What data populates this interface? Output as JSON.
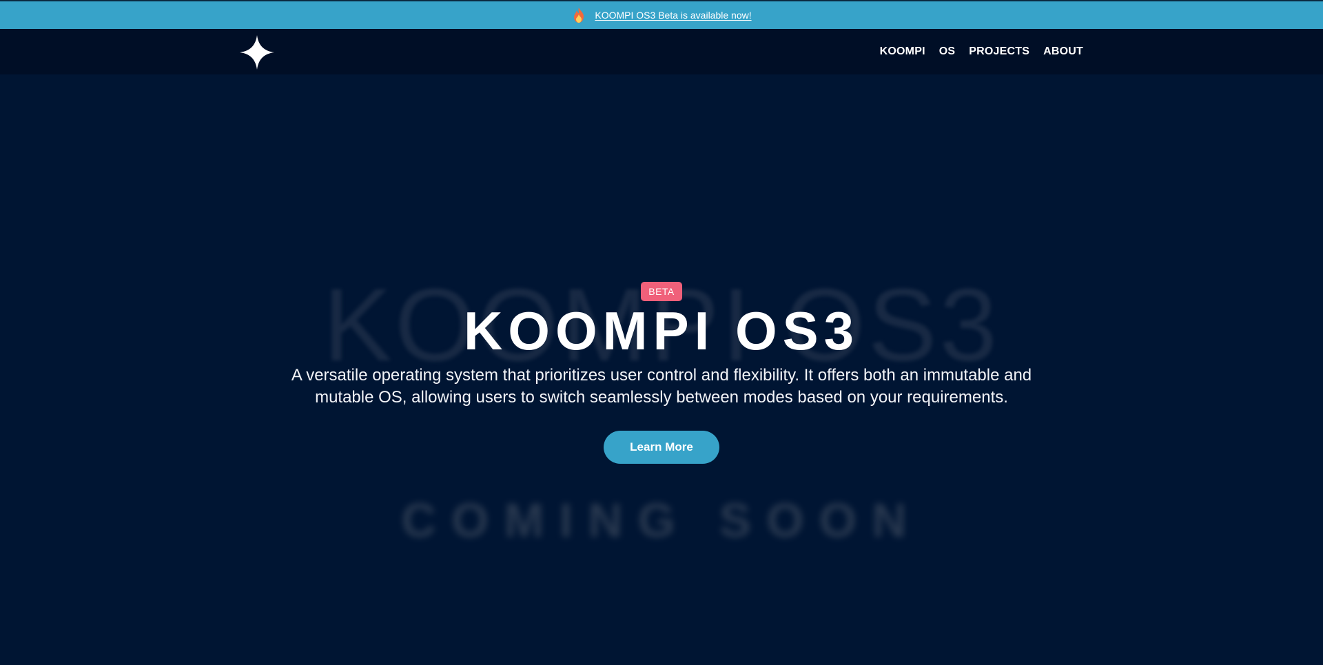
{
  "announcement": {
    "icon": "fire-icon",
    "text": "KOOMPI OS3 Beta is available now!"
  },
  "navbar": {
    "logo_icon": "four-point-star-logo",
    "links": [
      {
        "label": "KOOMPI"
      },
      {
        "label": "OS"
      },
      {
        "label": "PROJECTS"
      },
      {
        "label": "ABOUT"
      }
    ]
  },
  "hero": {
    "background_title": "KOOMPI OS3",
    "badge": "BETA",
    "title": "KOOMPI OS3",
    "description": "A versatile operating system that prioritizes user control and flexibility. It offers both an immutable and mutable OS, allowing users to switch seamlessly between modes based on your requirements.",
    "cta_label": "Learn More",
    "coming_soon": "COMING SOON"
  },
  "colors": {
    "announce_bar": "#37a3c9",
    "navbar_bg": "#000e26",
    "hero_bg": "#001533",
    "badge": "#f0607a",
    "button": "#37a3c9"
  }
}
